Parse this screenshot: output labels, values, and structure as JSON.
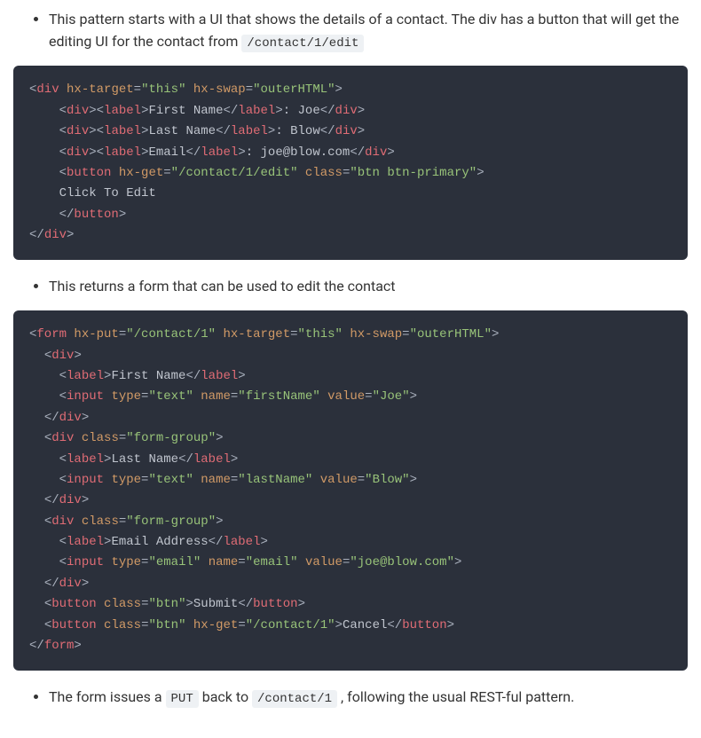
{
  "bullets": {
    "b1_pre": "This pattern starts with a UI that shows the details of a contact. The div has a button that will get the editing UI for the contact from ",
    "b1_code": "/contact/1/edit",
    "b2": "This returns a form that can be used to edit the contact",
    "b3_pre": "The form issues a ",
    "b3_code1": "PUT",
    "b3_mid": " back to ",
    "b3_code2": "/contact/1",
    "b3_post": ", following the usual REST-ful pattern."
  },
  "code1": {
    "l1": {
      "tag1": "div",
      "a1": "hx-target",
      "v1": "this",
      "a2": "hx-swap",
      "v2": "outerHTML"
    },
    "l2": {
      "tagOuter": "div",
      "tagLabel": "label",
      "labelText": "First Name",
      "after": ": Joe"
    },
    "l3": {
      "tagOuter": "div",
      "tagLabel": "label",
      "labelText": "Last Name",
      "after": ": Blow"
    },
    "l4": {
      "tagOuter": "div",
      "tagLabel": "label",
      "labelText": "Email",
      "after": ": joe@blow.com"
    },
    "l5": {
      "tag": "button",
      "a1": "hx-get",
      "v1": "/contact/1/edit",
      "a2": "class",
      "v2": "btn btn-primary"
    },
    "l6": {
      "text": "Click To Edit"
    },
    "l7": {
      "tag": "button"
    },
    "l8": {
      "tag": "div"
    }
  },
  "code2": {
    "l1": {
      "tag": "form",
      "a1": "hx-put",
      "v1": "/contact/1",
      "a2": "hx-target",
      "v2": "this",
      "a3": "hx-swap",
      "v3": "outerHTML"
    },
    "l2": {
      "tag": "div"
    },
    "l3": {
      "tag": "label",
      "text": "First Name"
    },
    "l4": {
      "tag": "input",
      "a1": "type",
      "v1": "text",
      "a2": "name",
      "v2": "firstName",
      "a3": "value",
      "v3": "Joe"
    },
    "l5": {
      "tag": "div"
    },
    "l6": {
      "tag": "div",
      "a1": "class",
      "v1": "form-group"
    },
    "l7": {
      "tag": "label",
      "text": "Last Name"
    },
    "l8": {
      "tag": "input",
      "a1": "type",
      "v1": "text",
      "a2": "name",
      "v2": "lastName",
      "a3": "value",
      "v3": "Blow"
    },
    "l9": {
      "tag": "div"
    },
    "l10": {
      "tag": "div",
      "a1": "class",
      "v1": "form-group"
    },
    "l11": {
      "tag": "label",
      "text": "Email Address"
    },
    "l12": {
      "tag": "input",
      "a1": "type",
      "v1": "email",
      "a2": "name",
      "v2": "email",
      "a3": "value",
      "v3": "joe@blow.com"
    },
    "l13": {
      "tag": "div"
    },
    "l14": {
      "tag": "button",
      "a1": "class",
      "v1": "btn",
      "text": "Submit"
    },
    "l15": {
      "tag": "button",
      "a1": "class",
      "v1": "btn",
      "a2": "hx-get",
      "v2": "/contact/1",
      "text": "Cancel"
    },
    "l16": {
      "tag": "form"
    }
  }
}
